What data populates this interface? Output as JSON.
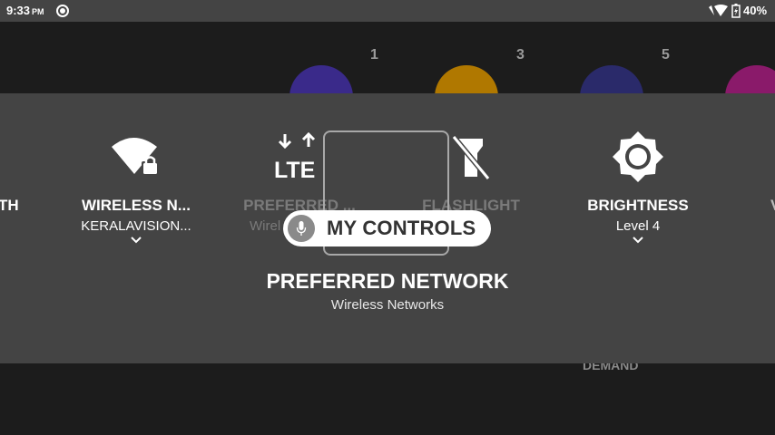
{
  "status_bar": {
    "time": "9:33",
    "ampm": "PM",
    "battery": "40%",
    "icons": [
      "settings-icon",
      "wifi-icon",
      "battery-charging-icon"
    ]
  },
  "background_apps": {
    "numbers": [
      "1",
      "3",
      "5"
    ],
    "label": "DEMAND",
    "circle_colors": [
      "#3a2a8a",
      "#b07800",
      "#2a2a6a",
      "#8a1a6a"
    ]
  },
  "controls": {
    "left_edge_text": "TH",
    "right_edge_text": "V",
    "tiles": [
      {
        "icon": "wifi-lock-icon",
        "title": "WIRELESS N...",
        "subtitle": "KERALAVISION..."
      },
      {
        "icon": "lte-icon",
        "title": "PREFERRED ...",
        "subtitle": "Wirel"
      },
      {
        "icon": "flashlight-off-icon",
        "title": "FLASHLIGHT",
        "subtitle": ""
      },
      {
        "icon": "brightness-icon",
        "title": "BRIGHTNESS",
        "subtitle": "Level 4"
      }
    ],
    "badge": {
      "label": "MY CONTROLS",
      "icon": "mic-icon"
    },
    "focused": {
      "title": "PREFERRED NETWORK",
      "subtitle": "Wireless Networks"
    }
  },
  "colors": {
    "panel": "#444444",
    "background": "#1c1c1c",
    "badge": "#ffffff"
  }
}
